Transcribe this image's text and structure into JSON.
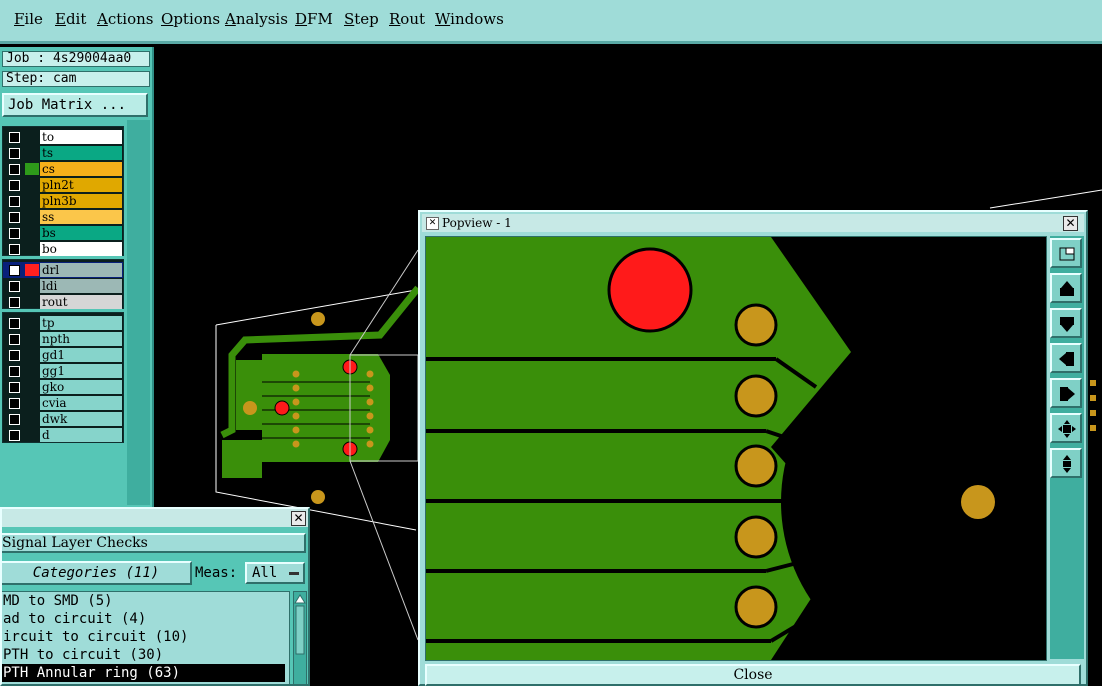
{
  "menu": [
    "File",
    "Edit",
    "Actions",
    "Options",
    "Analysis",
    "DFM",
    "Step",
    "Rout",
    "Windows"
  ],
  "job": {
    "job_line": "Job : 4s29004aa0",
    "step_line": "Step: cam",
    "matrix_button": "Job Matrix ..."
  },
  "layers_board": [
    {
      "name": "to",
      "color": "#ffffff"
    },
    {
      "name": "ts",
      "color": "#0aa884"
    },
    {
      "name": "cs",
      "color": "#f5b01a",
      "swatch": "#2e9a1a"
    },
    {
      "name": "pln2t",
      "color": "#e0a800"
    },
    {
      "name": "pln3b",
      "color": "#e0a800"
    },
    {
      "name": "ss",
      "color": "#fbc64a"
    },
    {
      "name": "bs",
      "color": "#0aa884"
    },
    {
      "name": "bo",
      "color": "#ffffff"
    }
  ],
  "layers_drill": [
    {
      "name": "drl",
      "color": "#9cb8b5",
      "swatch": "#ff2020",
      "active": true
    },
    {
      "name": "ldi",
      "color": "#9cb8b5"
    },
    {
      "name": "rout",
      "color": "#d6d6d6"
    }
  ],
  "layers_misc": [
    {
      "name": "tp"
    },
    {
      "name": "npth"
    },
    {
      "name": "gd1"
    },
    {
      "name": "gg1"
    },
    {
      "name": "gko"
    },
    {
      "name": "cvia"
    },
    {
      "name": "dwk"
    },
    {
      "name": "d"
    }
  ],
  "popview": {
    "title": "Popview - 1",
    "close_label": "Close"
  },
  "toolbar_icons": [
    "zoom-window-icon",
    "pan-up-icon",
    "pan-down-icon",
    "pan-left-icon",
    "pan-right-icon",
    "zoom-fit-icon",
    "zoom-home-icon"
  ],
  "signal_checks": {
    "heading": "Signal Layer Checks",
    "categories_label": "Categories (11)",
    "meas_label": "Meas:",
    "meas_value": "All",
    "items": [
      {
        "text": "MD to SMD (5)"
      },
      {
        "text": "ad to circuit (4)"
      },
      {
        "text": "ircuit to circuit (10)"
      },
      {
        "text": "PTH to circuit (30)"
      },
      {
        "text": "PTH Annular ring (63)",
        "selected": true
      }
    ]
  },
  "colors": {
    "panel": "#56c6b6",
    "menubar": "#9fdcd8",
    "copper": "#3a8f0a",
    "pad": "#c8961c",
    "drill": "#ff1a1a"
  }
}
